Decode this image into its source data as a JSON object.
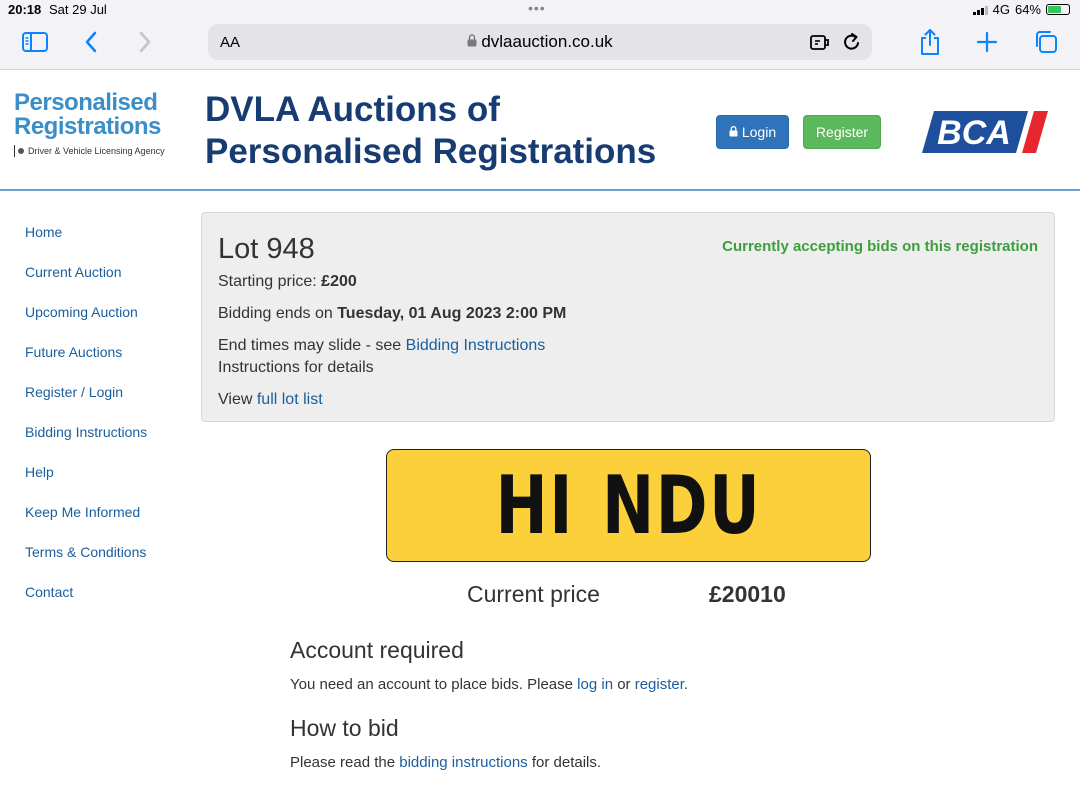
{
  "status_bar": {
    "time": "20:18",
    "date": "Sat 29 Jul",
    "network": "4G",
    "battery": "64%"
  },
  "browser": {
    "text_size_label": "AA",
    "url": "dvlaauction.co.uk",
    "icons": [
      "sidebar-icon",
      "back-icon",
      "forward-icon",
      "lock-icon",
      "extension-icon",
      "reload-icon",
      "share-icon",
      "new-tab-icon",
      "tabs-icon"
    ]
  },
  "header": {
    "logo_line1": "Personalised",
    "logo_line2": "Registrations",
    "logo_agency": "Driver & Vehicle Licensing Agency",
    "title_line1": "DVLA Auctions of",
    "title_line2": "Personalised Registrations",
    "login_label": "Login",
    "register_label": "Register",
    "partner_logo": "BCA"
  },
  "sidebar": {
    "items": [
      {
        "label": "Home"
      },
      {
        "label": "Current Auction"
      },
      {
        "label": "Upcoming Auction"
      },
      {
        "label": "Future Auctions"
      },
      {
        "label": "Register / Login"
      },
      {
        "label": "Bidding Instructions"
      },
      {
        "label": "Help"
      },
      {
        "label": "Keep Me Informed"
      },
      {
        "label": "Terms & Conditions"
      },
      {
        "label": "Contact"
      }
    ]
  },
  "lot": {
    "title": "Lot 948",
    "status": "Currently accepting bids on this registration",
    "starting_price_label": "Starting price:",
    "starting_price": "£200",
    "ends_label": "Bidding ends on",
    "ends_value": "Tuesday, 01 Aug 2023 2:00 PM",
    "slide_text_before": "End times may slide - see",
    "slide_link": "Bidding Instructions",
    "slide_text_after": "Instructions for details",
    "view_label": "View",
    "view_link": "full lot list"
  },
  "plate": {
    "registration": "HI NDU"
  },
  "price": {
    "label": "Current price",
    "value": "£20010"
  },
  "account": {
    "heading": "Account required",
    "text_before": "You need an account to place bids. Please",
    "login_link": "log in",
    "or": "or",
    "register_link": "register",
    "end": "."
  },
  "how_to_bid": {
    "heading": "How to bid",
    "text_before": "Please read the",
    "link": "bidding instructions",
    "text_after": "for details."
  },
  "colors": {
    "title_blue": "#173c72",
    "link_blue": "#1a5e9e",
    "status_green": "#3d9e3d",
    "login_button": "#2f74bb",
    "register_button": "#5cb85c",
    "plate_yellow": "#fcd03b",
    "bca_blue": "#1d4f9c",
    "bca_red": "#e8262e"
  }
}
